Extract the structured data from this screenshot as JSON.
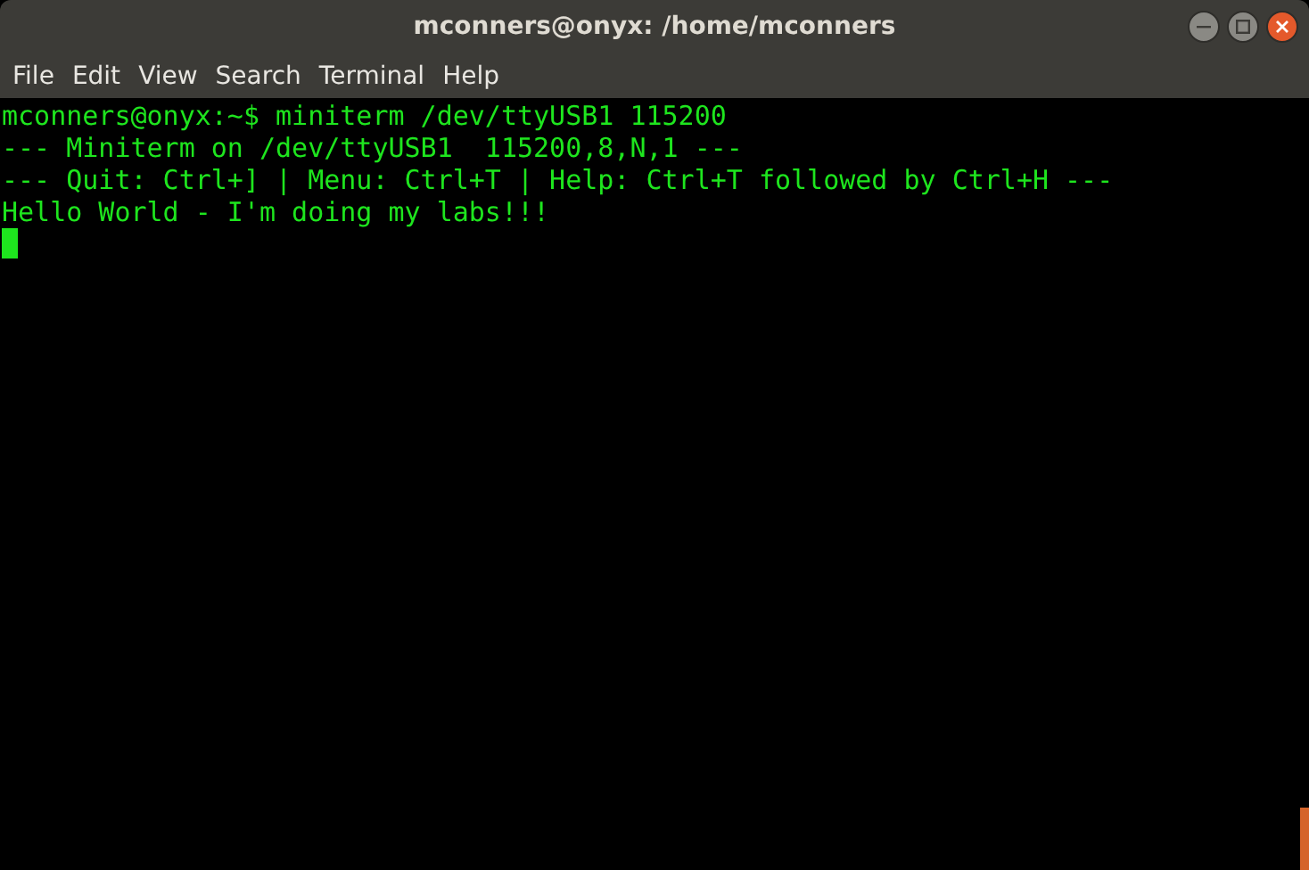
{
  "window": {
    "title": "mconners@onyx: /home/mconners"
  },
  "menu": [
    "File",
    "Edit",
    "View",
    "Search",
    "Terminal",
    "Help"
  ],
  "terminal": {
    "lines": [
      "mconners@onyx:~$ miniterm /dev/ttyUSB1 115200",
      "--- Miniterm on /dev/ttyUSB1  115200,8,N,1 ---",
      "--- Quit: Ctrl+] | Menu: Ctrl+T | Help: Ctrl+T followed by Ctrl+H ---",
      "Hello World - I'm doing my labs!!!"
    ]
  }
}
